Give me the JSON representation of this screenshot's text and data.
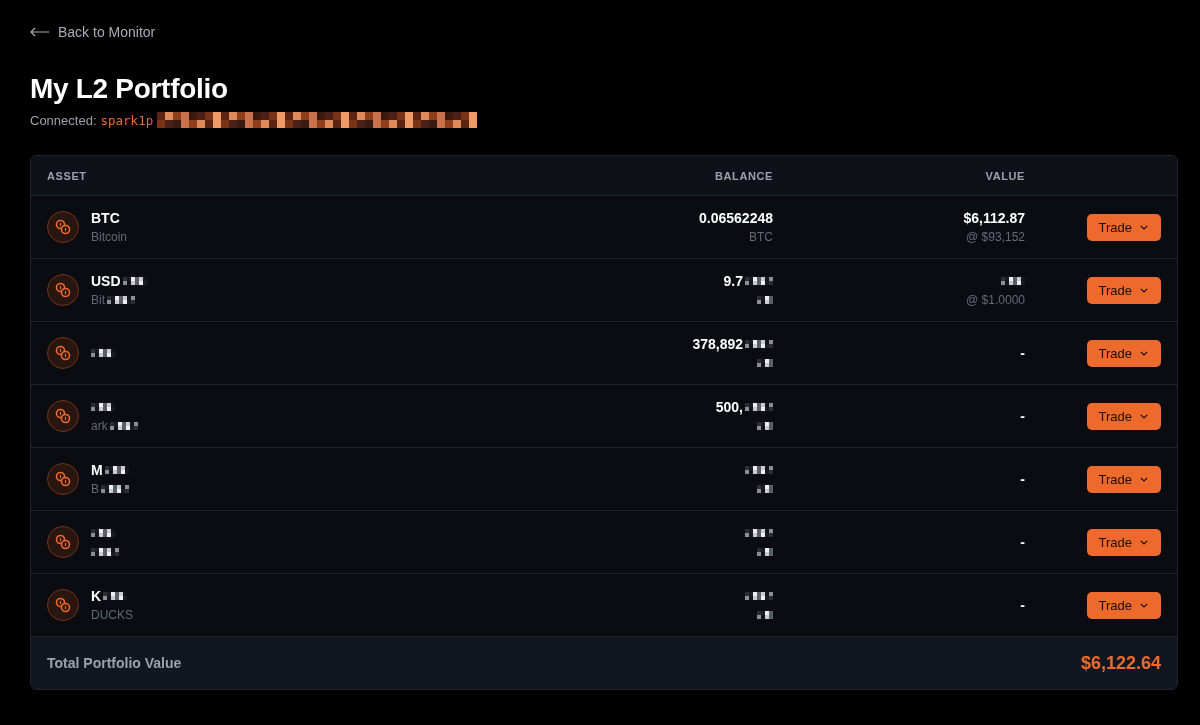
{
  "back_link": {
    "label": "Back to Monitor"
  },
  "title": "My L2 Portfolio",
  "connection": {
    "label": "Connected:",
    "address": {
      "text": "spark1p",
      "masked": true
    }
  },
  "table": {
    "columns": [
      "ASSET",
      "BALANCE",
      "VALUE"
    ],
    "rows": [
      {
        "name": {
          "text": "BTC",
          "masked": false
        },
        "subtitle": {
          "text": "Bitcoin",
          "masked": false
        },
        "balance": {
          "text": "0.06562248",
          "masked": false
        },
        "unit": {
          "text": "BTC",
          "masked": false
        },
        "value": {
          "text": "$6,112.87",
          "masked": false
        },
        "price": {
          "text": "@ $93,152",
          "masked": false
        },
        "action": "Trade"
      },
      {
        "name": {
          "text": "USD",
          "masked": true
        },
        "subtitle": {
          "text": "Bit",
          "masked": true
        },
        "balance": {
          "text": "9.7",
          "masked": true
        },
        "unit": {
          "masked": true
        },
        "value": {
          "masked": true
        },
        "price": {
          "text": "@ $1.0000",
          "masked": false
        },
        "action": "Trade"
      },
      {
        "name": {
          "masked": true
        },
        "balance": {
          "text": "378,892",
          "masked": true
        },
        "unit": {
          "masked": true
        },
        "value": {
          "text": "-",
          "masked": false
        },
        "action": "Trade"
      },
      {
        "name": {
          "masked": true
        },
        "subtitle": {
          "text": "ark",
          "masked": true
        },
        "balance": {
          "text": "500,",
          "masked": true
        },
        "unit": {
          "masked": true
        },
        "value": {
          "text": "-",
          "masked": false
        },
        "action": "Trade"
      },
      {
        "name": {
          "text": "M",
          "masked": true
        },
        "subtitle": {
          "text": "B",
          "masked": true
        },
        "balance": {
          "masked": true
        },
        "unit": {
          "masked": true
        },
        "value": {
          "text": "-",
          "masked": false
        },
        "action": "Trade"
      },
      {
        "name": {
          "masked": true
        },
        "subtitle": {
          "masked": true
        },
        "balance": {
          "masked": true
        },
        "unit": {
          "masked": true
        },
        "value": {
          "text": "-",
          "masked": false
        },
        "action": "Trade"
      },
      {
        "name": {
          "text": "K",
          "masked": true
        },
        "subtitle": {
          "text": "DUCKS",
          "masked": false
        },
        "balance": {
          "masked": true
        },
        "unit": {
          "masked": true
        },
        "value": {
          "text": "-",
          "masked": false
        },
        "action": "Trade"
      }
    ],
    "footer": {
      "label": "Total Portfolio Value",
      "total": "$6,122.64"
    }
  }
}
